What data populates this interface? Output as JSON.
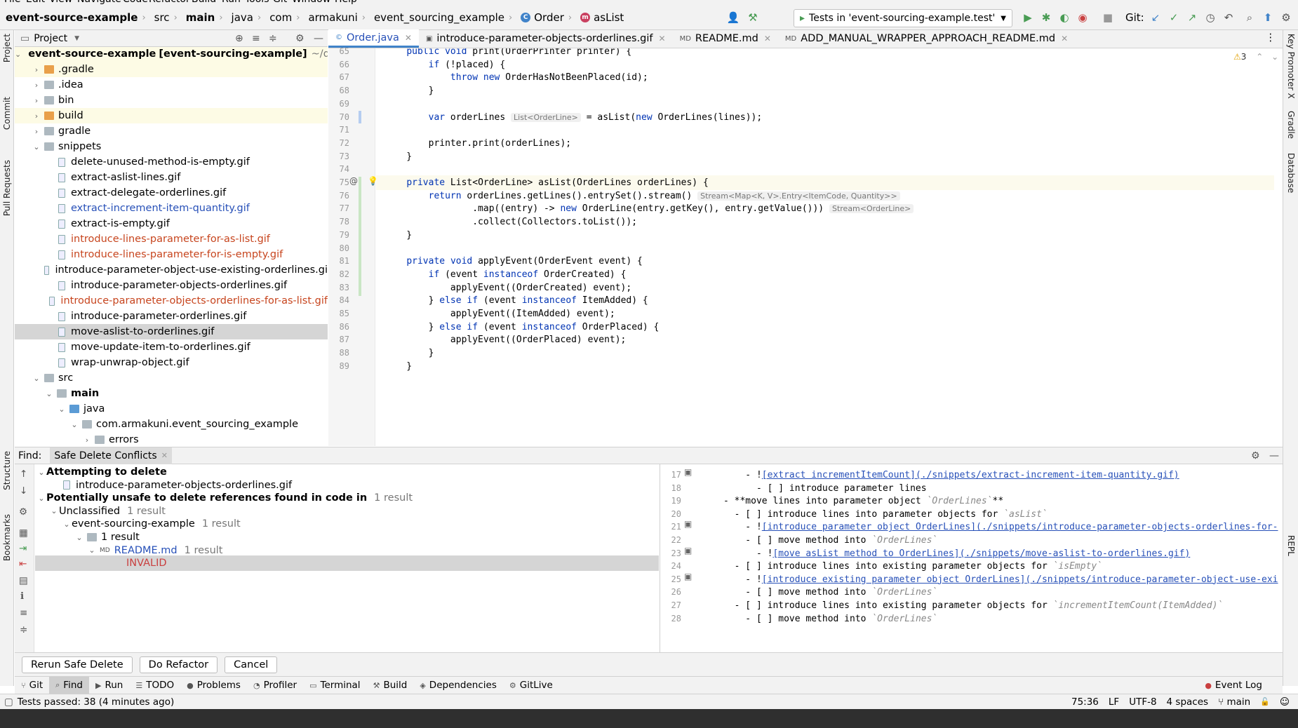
{
  "menu": [
    "File",
    "Edit",
    "View",
    "Navigate",
    "Code",
    "Refactor",
    "Build",
    "Run",
    "Tools",
    "Git",
    "Window",
    "Help"
  ],
  "breadcrumbs": [
    "event-source-example",
    "src",
    "main",
    "java",
    "com",
    "armakuni",
    "event_sourcing_example",
    "Order",
    "asList"
  ],
  "run_config": "Tests in 'event-sourcing-example.test'",
  "git_label": "Git:",
  "project_panel": {
    "title": "Project"
  },
  "tree": [
    {
      "label": "event-source-example",
      "suffix": "[event-sourcing-example]",
      "path": "~/dev/in",
      "depth": 0,
      "type": "root",
      "open": true
    },
    {
      "label": ".gradle",
      "depth": 1,
      "type": "folder-orange",
      "open": false
    },
    {
      "label": ".idea",
      "depth": 1,
      "type": "folder",
      "open": false
    },
    {
      "label": "bin",
      "depth": 1,
      "type": "folder",
      "open": false
    },
    {
      "label": "build",
      "depth": 1,
      "type": "folder-orange",
      "open": false
    },
    {
      "label": "gradle",
      "depth": 1,
      "type": "folder",
      "open": false
    },
    {
      "label": "snippets",
      "depth": 1,
      "type": "folder",
      "open": true
    },
    {
      "label": "delete-unused-method-is-empty.gif",
      "depth": 2,
      "type": "file",
      "color": "normal"
    },
    {
      "label": "extract-aslist-lines.gif",
      "depth": 2,
      "type": "file",
      "color": "normal"
    },
    {
      "label": "extract-delegate-orderlines.gif",
      "depth": 2,
      "type": "file",
      "color": "normal"
    },
    {
      "label": "extract-increment-item-quantity.gif",
      "depth": 2,
      "type": "file",
      "color": "blue"
    },
    {
      "label": "extract-is-empty.gif",
      "depth": 2,
      "type": "file",
      "color": "normal"
    },
    {
      "label": "introduce-lines-parameter-for-as-list.gif",
      "depth": 2,
      "type": "file",
      "color": "red"
    },
    {
      "label": "introduce-lines-parameter-for-is-empty.gif",
      "depth": 2,
      "type": "file",
      "color": "red"
    },
    {
      "label": "introduce-parameter-object-use-existing-orderlines.gi",
      "depth": 2,
      "type": "file",
      "color": "normal"
    },
    {
      "label": "introduce-parameter-objects-orderlines.gif",
      "depth": 2,
      "type": "file",
      "color": "normal"
    },
    {
      "label": "introduce-parameter-objects-orderlines-for-as-list.gif",
      "depth": 2,
      "type": "file",
      "color": "red"
    },
    {
      "label": "introduce-parameter-orderlines.gif",
      "depth": 2,
      "type": "file",
      "color": "normal"
    },
    {
      "label": "move-aslist-to-orderlines.gif",
      "depth": 2,
      "type": "file",
      "color": "normal",
      "selected": true
    },
    {
      "label": "move-update-item-to-orderlines.gif",
      "depth": 2,
      "type": "file",
      "color": "normal"
    },
    {
      "label": "wrap-unwrap-object.gif",
      "depth": 2,
      "type": "file",
      "color": "normal"
    },
    {
      "label": "src",
      "depth": 1,
      "type": "folder",
      "open": true
    },
    {
      "label": "main",
      "depth": 2,
      "type": "folder",
      "open": true,
      "bold": true
    },
    {
      "label": "java",
      "depth": 3,
      "type": "folder-blue",
      "open": true
    },
    {
      "label": "com.armakuni.event_sourcing_example",
      "depth": 4,
      "type": "folder",
      "open": true
    },
    {
      "label": "errors",
      "depth": 5,
      "type": "folder",
      "open": false
    }
  ],
  "editor_tabs": [
    {
      "label": "Order.java",
      "active": true
    },
    {
      "label": "introduce-parameter-objects-orderlines.gif",
      "active": false
    },
    {
      "label": "README.md",
      "active": false
    },
    {
      "label": "ADD_MANUAL_WRAPPER_APPROACH_README.md",
      "active": false
    }
  ],
  "warnings": "3",
  "code_lines": [
    {
      "n": "65",
      "text": "    public void print(OrderPrinter printer) {"
    },
    {
      "n": "66",
      "text": "        if (!placed) {"
    },
    {
      "n": "67",
      "text": "            throw new OrderHasNotBeenPlaced(id);"
    },
    {
      "n": "68",
      "text": "        }"
    },
    {
      "n": "69",
      "text": ""
    },
    {
      "n": "70",
      "text": "        var orderLines ",
      "hint": "List<OrderLine>",
      "after": " = asList(new OrderLines(lines));"
    },
    {
      "n": "71",
      "text": ""
    },
    {
      "n": "72",
      "text": "        printer.print(orderLines);"
    },
    {
      "n": "73",
      "text": "    }"
    },
    {
      "n": "74",
      "text": ""
    },
    {
      "n": "75",
      "text": "    private List<OrderLine> asList(OrderLines orderLines) {",
      "current": true
    },
    {
      "n": "76",
      "text": "        return orderLines.getLines().entrySet().stream() ",
      "hint": "Stream<Map<K, V>.Entry<ItemCode, Quantity>>"
    },
    {
      "n": "77",
      "text": "                .map((entry) -> new OrderLine(entry.getKey(), entry.getValue())) ",
      "hint": "Stream<OrderLine>"
    },
    {
      "n": "78",
      "text": "                .collect(Collectors.toList());"
    },
    {
      "n": "79",
      "text": "    }"
    },
    {
      "n": "80",
      "text": ""
    },
    {
      "n": "81",
      "text": "    private void applyEvent(OrderEvent event) {"
    },
    {
      "n": "82",
      "text": "        if (event instanceof OrderCreated) {"
    },
    {
      "n": "83",
      "text": "            applyEvent((OrderCreated) event);"
    },
    {
      "n": "84",
      "text": "        } else if (event instanceof ItemAdded) {"
    },
    {
      "n": "85",
      "text": "            applyEvent((ItemAdded) event);"
    },
    {
      "n": "86",
      "text": "        } else if (event instanceof OrderPlaced) {"
    },
    {
      "n": "87",
      "text": "            applyEvent((OrderPlaced) event);"
    },
    {
      "n": "88",
      "text": "        }"
    },
    {
      "n": "89",
      "text": "    }"
    }
  ],
  "find": {
    "label": "Find:",
    "tab": "Safe Delete Conflicts",
    "rows": [
      {
        "text": "Attempting to delete",
        "depth": 0,
        "bold": true,
        "open": true
      },
      {
        "text": "introduce-parameter-objects-orderlines.gif",
        "depth": 1,
        "icon": "file"
      },
      {
        "text": "Potentially unsafe to delete references found in code in",
        "count": "1 result",
        "depth": 0,
        "bold": true,
        "open": true
      },
      {
        "text": "Unclassified",
        "count": "1 result",
        "depth": 1,
        "open": true
      },
      {
        "text": "event-sourcing-example",
        "count": "1 result",
        "depth": 2,
        "open": true
      },
      {
        "text": "1 result",
        "depth": 3,
        "open": true,
        "icon": "folder"
      },
      {
        "text": "README.md",
        "count": "1 result",
        "depth": 4,
        "open": true,
        "icon": "md",
        "blue": true
      },
      {
        "text": "INVALID",
        "depth": 5,
        "red": true,
        "selected": true
      }
    ],
    "buttons": [
      "Rerun Safe Delete",
      "Do Refactor",
      "Cancel"
    ]
  },
  "preview_lines": [
    {
      "n": "17",
      "parts": [
        [
          "    - !",
          ""
        ],
        [
          "[extract incrementItemCount]",
          "lk"
        ],
        [
          "(./snippets/extract-increment-item-quantity.gif)",
          "lk"
        ]
      ]
    },
    {
      "n": "18",
      "parts": [
        [
          "      - [ ] introduce parameter lines",
          ""
        ]
      ]
    },
    {
      "n": "19",
      "parts": [
        [
          "- **move lines into parameter object ",
          ""
        ],
        [
          "`OrderLines`",
          "ic"
        ],
        [
          "**",
          ""
        ]
      ]
    },
    {
      "n": "20",
      "parts": [
        [
          "  - [ ] introduce lines into parameter objects for ",
          ""
        ],
        [
          "`asList`",
          "ic"
        ]
      ]
    },
    {
      "n": "21",
      "parts": [
        [
          "    - !",
          ""
        ],
        [
          "[introduce parameter object OrderLines]",
          "lk"
        ],
        [
          "(./snippets/introduce-parameter-objects-orderlines-for-",
          "lk"
        ]
      ]
    },
    {
      "n": "22",
      "parts": [
        [
          "    - [ ] move method into ",
          ""
        ],
        [
          "`OrderLines`",
          "ic"
        ]
      ]
    },
    {
      "n": "23",
      "parts": [
        [
          "      - !",
          ""
        ],
        [
          "[move asList method to OrderLines]",
          "lk"
        ],
        [
          "(./snippets/move-aslist-to-orderlines.gif)",
          "lk"
        ]
      ]
    },
    {
      "n": "24",
      "parts": [
        [
          "  - [ ] introduce lines into existing parameter objects for ",
          ""
        ],
        [
          "`isEmpty`",
          "ic"
        ]
      ]
    },
    {
      "n": "25",
      "parts": [
        [
          "    - !",
          ""
        ],
        [
          "[introduce existing parameter object OrderLines]",
          "lk"
        ],
        [
          "(./snippets/introduce-parameter-object-use-exi",
          "lk"
        ]
      ]
    },
    {
      "n": "26",
      "parts": [
        [
          "    - [ ] move method into ",
          ""
        ],
        [
          "`OrderLines`",
          "ic"
        ]
      ]
    },
    {
      "n": "27",
      "parts": [
        [
          "  - [ ] introduce lines into existing parameter objects for ",
          ""
        ],
        [
          "`incrementItemCount(ItemAdded)`",
          "ic"
        ]
      ]
    },
    {
      "n": "28",
      "parts": [
        [
          "    - [ ] move method into ",
          ""
        ],
        [
          "`OrderLines`",
          "ic"
        ]
      ]
    }
  ],
  "tool_windows": [
    "Git",
    "Find",
    "Run",
    "TODO",
    "Problems",
    "Profiler",
    "Terminal",
    "Build",
    "Dependencies",
    "GitLive"
  ],
  "event_log": "Event Log",
  "status": {
    "message": "Tests passed: 38 (4 minutes ago)",
    "position": "75:36",
    "line_sep": "LF",
    "encoding": "UTF-8",
    "indent": "4 spaces",
    "branch": "main"
  },
  "left_strip": [
    "Project",
    "Commit",
    "Pull Requests",
    "Structure",
    "Bookmarks"
  ],
  "right_strip": [
    "Key Promoter X",
    "Gradle",
    "Database",
    "REPL"
  ]
}
